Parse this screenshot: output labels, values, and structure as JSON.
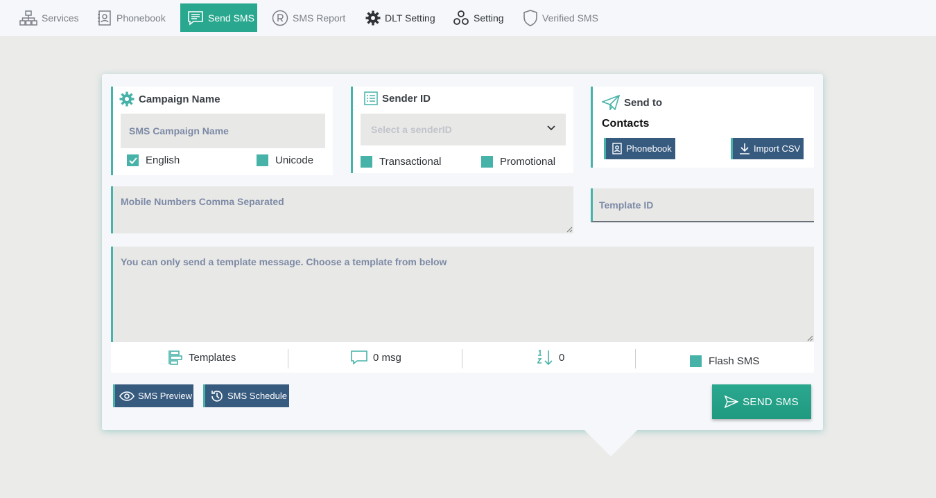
{
  "nav": {
    "services": "Services",
    "phonebook": "Phonebook",
    "send_sms": "Send SMS",
    "sms_report": "SMS Report",
    "dlt_setting": "DLT Setting",
    "setting": "Setting",
    "verified_sms": "Verified SMS"
  },
  "campaign": {
    "title": "Campaign Name",
    "placeholder": "SMS Campaign Name",
    "english": "English",
    "unicode": "Unicode"
  },
  "sender": {
    "title": "Sender ID",
    "select_placeholder": "Select a senderID",
    "transactional": "Transactional",
    "promotional": "Promotional"
  },
  "send_to": {
    "title": "Send to",
    "subtitle": "Contacts",
    "phonebook_button": "Phonebook",
    "import_button": "Import CSV"
  },
  "mobile_numbers": {
    "placeholder": "Mobile Numbers Comma Separated"
  },
  "template_id": {
    "placeholder": "Template ID"
  },
  "message": {
    "placeholder": "You can only send a template message. Choose a template from below"
  },
  "stats": {
    "templates": "Templates",
    "msg_count": "0 msg",
    "sort_count": "0",
    "flash_sms": "Flash SMS"
  },
  "actions": {
    "preview": "SMS Preview",
    "schedule": "SMS Schedule",
    "send": "SEND SMS"
  },
  "colors": {
    "accent": "#2aa88f",
    "teal_check": "#47b2a8",
    "button_dark": "#375a7f",
    "placeholder_text": "#7d8aa6"
  },
  "icons": [
    "sitemap-icon",
    "contact-book-icon",
    "message-icon",
    "registered-icon",
    "gear-icon",
    "cogs-icon",
    "shield-icon",
    "paper-plane-icon",
    "sender-list-icon",
    "chevron-down-icon",
    "download-icon",
    "templates-icon",
    "chat-bubble-icon",
    "sort-numeric-icon",
    "eye-icon",
    "history-icon",
    "send-icon"
  ]
}
